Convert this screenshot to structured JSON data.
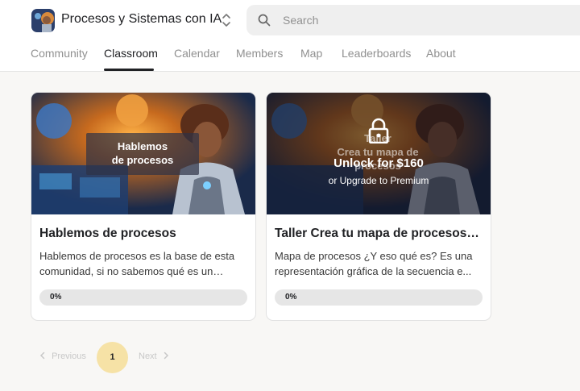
{
  "header": {
    "group_name": "Procesos y Sistemas con IA",
    "search_placeholder": "Search",
    "tabs": [
      {
        "label": "Community",
        "active": false
      },
      {
        "label": "Classroom",
        "active": true
      },
      {
        "label": "Calendar",
        "active": false
      },
      {
        "label": "Members",
        "active": false
      },
      {
        "label": "Map",
        "active": false
      },
      {
        "label": "Leaderboards",
        "active": false
      },
      {
        "label": "About",
        "active": false
      }
    ]
  },
  "courses": [
    {
      "thumb_label_lines": [
        "Hablemos",
        "de procesos"
      ],
      "title": "Hablemos de procesos",
      "description": "Hablemos de procesos es la base de esta comunidad, si no sabemos qué es un…",
      "progress": 0,
      "progress_text": "0%",
      "locked": false
    },
    {
      "thumb_label_lines": [
        "Taller",
        "Crea tu mapa de",
        "procesos"
      ],
      "title": "Taller Crea tu mapa de procesos e...",
      "description": "Mapa de procesos ¿Y eso qué es? Es una representación gráfica de la secuencia e...",
      "progress": 0,
      "progress_text": "0%",
      "locked": true,
      "unlock_text": "Unlock for $160",
      "upgrade_text": "or Upgrade to Premium"
    }
  ],
  "pagination": {
    "prev_label": "Previous",
    "current_page": "1",
    "next_label": "Next"
  },
  "icons": [
    "group-logo-icon",
    "switch-chevrons-icon",
    "search-icon",
    "lock-icon",
    "chevron-left-icon",
    "chevron-right-icon"
  ],
  "colors": {
    "accent_yellow": "#f6e2a6",
    "progress_track": "#e6e6e6",
    "text_muted": "#909090"
  }
}
